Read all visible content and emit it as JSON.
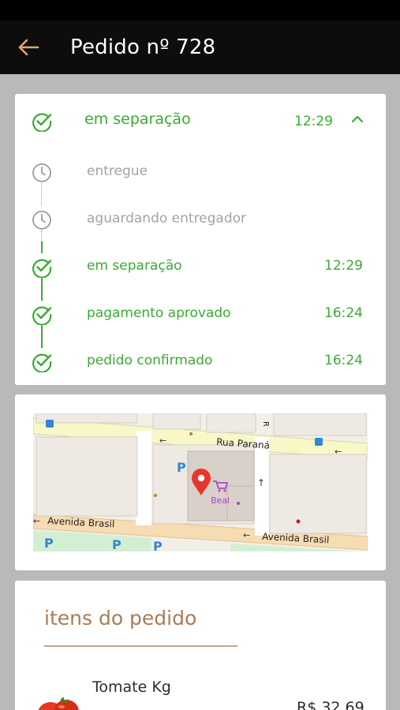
{
  "header": {
    "title": "Pedido nº 728",
    "back_icon": "arrow-left-icon",
    "back_color": "#e0a86a"
  },
  "status": {
    "current": {
      "label": "em separação",
      "time": "12:29",
      "icon": "check-circle-icon",
      "toggle_icon": "chevron-up-icon"
    },
    "timeline": [
      {
        "label": "entregue",
        "time": "",
        "state": "pending",
        "icon": "clock-icon"
      },
      {
        "label": "aguardando entregador",
        "time": "",
        "state": "pending",
        "icon": "clock-icon"
      },
      {
        "label": "em separação",
        "time": "12:29",
        "state": "done",
        "icon": "check-circle-icon"
      },
      {
        "label": "pagamento aprovado",
        "time": "16:24",
        "state": "done",
        "icon": "check-circle-icon"
      },
      {
        "label": "pedido confirmado",
        "time": "16:24",
        "state": "done",
        "icon": "check-circle-icon"
      }
    ]
  },
  "map": {
    "streets": [
      "Rua Paraná",
      "Avenida Brasil",
      "Avenida Brasil",
      "R"
    ],
    "store_label": "Beal",
    "parking_label": "P",
    "pin_icon": "map-pin-icon",
    "store_icon": "shopping-cart-icon"
  },
  "items": {
    "title": "itens do pedido",
    "products": [
      {
        "name": "Tomate Kg",
        "price": "R$ 32,69",
        "thumb": "tomato-icon"
      }
    ]
  },
  "colors": {
    "green": "#3aaa35",
    "gray": "#a3a3a3",
    "accent_brown": "#a87c57",
    "appbar": "#0d0d0d",
    "background": "#b9b9b9"
  }
}
